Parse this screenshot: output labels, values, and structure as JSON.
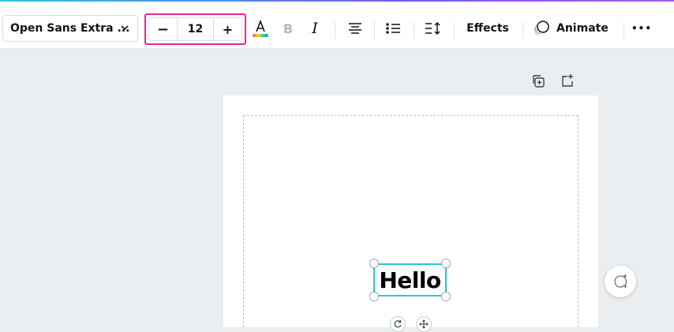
{
  "toolbar": {
    "font_name": "Open Sans Extra ...",
    "font_size": "12",
    "decrease_label": "−",
    "increase_label": "+",
    "bold_label": "B",
    "italic_label": "I",
    "effects_label": "Effects",
    "animate_label": "Animate",
    "more_label": "•••"
  },
  "canvas": {
    "text_content": "Hello"
  },
  "colors": {
    "accent_highlight": "#e5249a",
    "selection": "#2ec5d6",
    "canvas_bg": "#ebeef0"
  }
}
